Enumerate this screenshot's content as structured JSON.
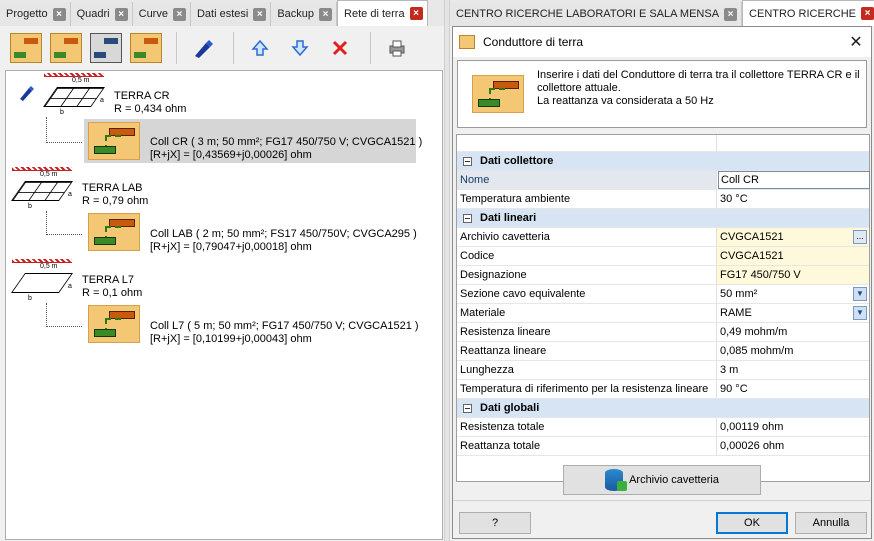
{
  "left_tabs": [
    {
      "label": "Progetto"
    },
    {
      "label": "Quadri"
    },
    {
      "label": "Curve"
    },
    {
      "label": "Dati estesi"
    },
    {
      "label": "Backup"
    },
    {
      "label": "Rete di terra"
    }
  ],
  "right_tabs": [
    {
      "label": "CENTRO RICERCHE LABORATORI E SALA MENSA"
    },
    {
      "label": "CENTRO RICERCHE"
    }
  ],
  "toolbar_icons": [
    "earth-electrode-icon",
    "earth-conductor-icon",
    "earth-collector-icon",
    "earth-connection-icon",
    "pen-icon",
    "arrow-up-icon",
    "arrow-down-icon",
    "delete-icon",
    "print-icon"
  ],
  "tree": {
    "dim_label": "0,5 m",
    "dim_a": "a",
    "dim_b": "b",
    "nodes": [
      {
        "name": "TERRA CR",
        "resistance": "R = 0,434 ohm",
        "coll_title": "Coll CR ( 3 m; 50 mm²; FG17 450/750 V; CVGCA1521 )",
        "coll_value": "[R+jX] = [0,43569+j0,00026] ohm"
      },
      {
        "name": "TERRA LAB",
        "resistance": "R = 0,79 ohm",
        "coll_title": "Coll LAB ( 2 m; 50 mm²; FS17 450/750V; CVGCA295 )",
        "coll_value": "[R+jX] = [0,79047+j0,00018] ohm"
      },
      {
        "name": "TERRA L7",
        "resistance": "R = 0,1 ohm",
        "coll_title": "Coll L7 ( 5 m; 50 mm²; FG17 450/750 V; CVGCA1521 )",
        "coll_value": "[R+jX] = [0,10199+j0,00043] ohm"
      }
    ]
  },
  "dialog": {
    "title": "Conduttore di terra",
    "info_line1": "Inserire i dati del Conduttore di terra tra il collettore TERRA CR e il collettore attuale.",
    "info_line2": "La reattanza va considerata a 50 Hz",
    "sections": {
      "collettore": "Dati collettore",
      "lineari": "Dati lineari",
      "globali": "Dati globali"
    },
    "props": {
      "nome": {
        "k": "Nome",
        "v": "Coll CR"
      },
      "temp_amb": {
        "k": "Temperatura ambiente",
        "v": "30 °C"
      },
      "archivio": {
        "k": "Archivio cavetteria",
        "v": "CVGCA1521"
      },
      "codice": {
        "k": "Codice",
        "v": "CVGCA1521"
      },
      "designazione": {
        "k": "Designazione",
        "v": "FG17 450/750 V"
      },
      "sezione": {
        "k": "Sezione cavo equivalente",
        "v": "50 mm²"
      },
      "materiale": {
        "k": "Materiale",
        "v": "RAME"
      },
      "res_lin": {
        "k": "Resistenza lineare",
        "v": "0,49 mohm/m"
      },
      "reat_lin": {
        "k": "Reattanza lineare",
        "v": "0,085 mohm/m"
      },
      "lunghezza": {
        "k": "Lunghezza",
        "v": "3 m"
      },
      "temp_rif": {
        "k": "Temperatura di riferimento per la resistenza lineare",
        "v": "90 °C"
      },
      "res_tot": {
        "k": "Resistenza totale",
        "v": "0,00119 ohm"
      },
      "reat_tot": {
        "k": "Reattanza totale",
        "v": "0,00026 ohm"
      }
    },
    "archivio_button": "Archivio cavetteria",
    "help_button": "?",
    "ok_button": "OK",
    "cancel_button": "Annulla",
    "ellipsis": "...",
    "dropdown_glyph": "▼"
  }
}
